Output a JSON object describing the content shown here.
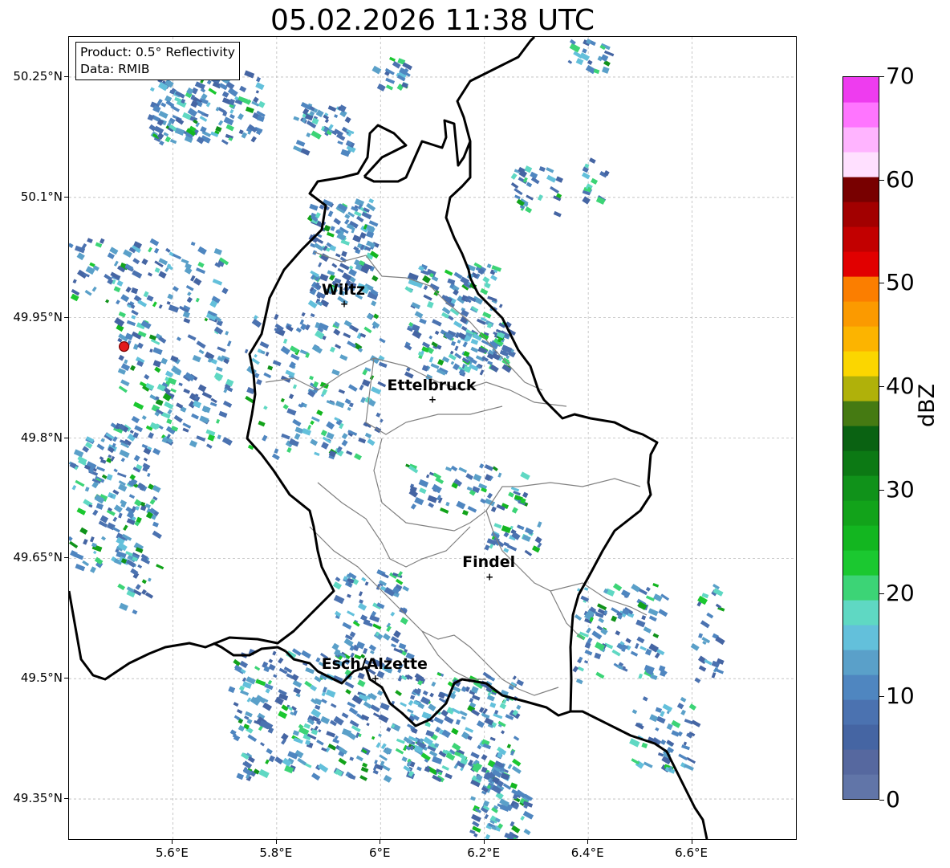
{
  "title": "05.02.2026 11:38 UTC",
  "info": {
    "product": "Product: 0.5° Reflectivity",
    "data_source": "Data: RMIB"
  },
  "map": {
    "lat_labels": [
      "50.25°N",
      "50.1°N",
      "49.95°N",
      "49.8°N",
      "49.65°N",
      "49.5°N",
      "49.35°N"
    ],
    "lon_labels": [
      "5.6°E",
      "5.8°E",
      "6°E",
      "6.2°E",
      "6.4°E",
      "6.6°E"
    ],
    "cities": [
      {
        "name": "Wiltz",
        "lon": 5.93,
        "lat": 49.967
      },
      {
        "name": "Ettelbruck",
        "lon": 6.1,
        "lat": 49.848
      },
      {
        "name": "Findel",
        "lon": 6.21,
        "lat": 49.627
      },
      {
        "name": "Esch/Alzette",
        "lon": 5.99,
        "lat": 49.5
      }
    ],
    "radar_site": {
      "lon": 5.506,
      "lat": 49.914,
      "color": "#e31a1c"
    },
    "extent": {
      "lon": [
        5.4,
        6.8
      ],
      "lat": [
        49.3,
        50.3
      ]
    }
  },
  "colorbar": {
    "unit": "dBZ",
    "tick_labels": [
      "70",
      "60",
      "50",
      "40",
      "30",
      "20",
      "10",
      "0"
    ],
    "min": 0,
    "max": 70,
    "colors": [
      "#6175a8",
      "#56689f",
      "#4565a3",
      "#4b72b0",
      "#4f86c0",
      "#5aa0c9",
      "#63c0db",
      "#5fd8c3",
      "#3cd476",
      "#1bc830",
      "#13b620",
      "#12a31a",
      "#10921a",
      "#0c7914",
      "#0a6212",
      "#457a12",
      "#b0b10a",
      "#fbd600",
      "#fcb400",
      "#fb9a00",
      "#fb7e00",
      "#e10000",
      "#c20000",
      "#a20000",
      "#780000",
      "#ffe0ff",
      "#ffb4ff",
      "#ff75ff",
      "#ee3cef"
    ]
  }
}
